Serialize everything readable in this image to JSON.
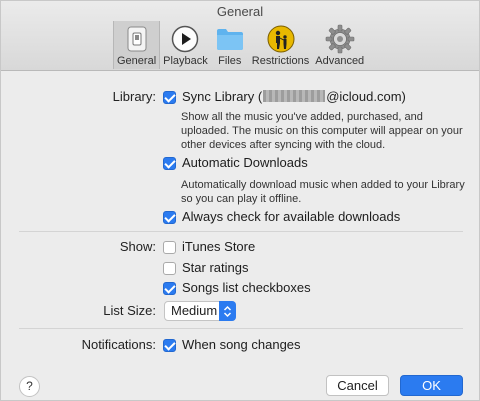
{
  "window": {
    "title": "General"
  },
  "toolbar": {
    "tabs": [
      {
        "label": "General",
        "icon": "general-switch-icon",
        "active": true
      },
      {
        "label": "Playback",
        "icon": "play-icon",
        "active": false
      },
      {
        "label": "Files",
        "icon": "folder-icon",
        "active": false
      },
      {
        "label": "Restrictions",
        "icon": "parental-restrictions-icon",
        "active": false
      },
      {
        "label": "Advanced",
        "icon": "gear-icon",
        "active": false
      }
    ]
  },
  "library": {
    "label": "Library:",
    "sync": {
      "label_prefix": "Sync Library (",
      "label_suffix": "@icloud.com)",
      "checked": true,
      "description": "Show all the music you've added, purchased, and uploaded. The music on this computer will appear on your other devices after syncing with the cloud."
    },
    "auto_downloads": {
      "label": "Automatic Downloads",
      "checked": true,
      "description": "Automatically download music when added to your Library so you can play it offline."
    },
    "always_check": {
      "label": "Always check for available downloads",
      "checked": true
    }
  },
  "show": {
    "label": "Show:",
    "items": [
      {
        "label": "iTunes Store",
        "checked": false
      },
      {
        "label": "Star ratings",
        "checked": false
      },
      {
        "label": "Songs list checkboxes",
        "checked": true
      }
    ]
  },
  "list_size": {
    "label": "List Size:",
    "value": "Medium"
  },
  "notifications": {
    "label": "Notifications:",
    "when_song_changes": {
      "label": "When song changes",
      "checked": true
    }
  },
  "footer": {
    "help_label": "?",
    "cancel_label": "Cancel",
    "ok_label": "OK"
  },
  "colors": {
    "accent": "#2b7bf0",
    "background": "#ececec"
  }
}
